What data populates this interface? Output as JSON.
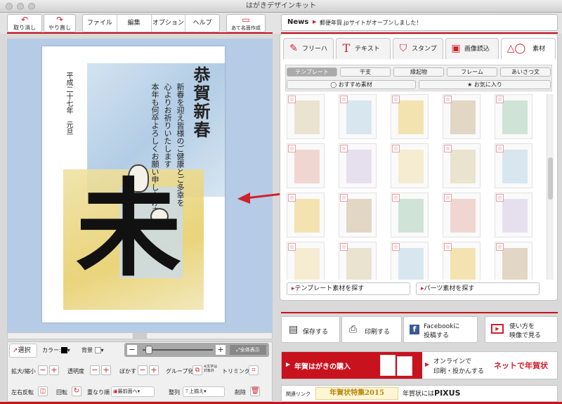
{
  "window": {
    "title": "はがきデザインキット"
  },
  "toolbar": {
    "undo": "取り消し",
    "redo": "やり直し",
    "menus": [
      "ファイル",
      "編集",
      "オプション",
      "ヘルプ"
    ],
    "address": "あて名面作成"
  },
  "news": {
    "label": "News",
    "text": "郵便年賀.jpサイトがオープンしました！"
  },
  "card": {
    "date": "平成二十七年　元旦",
    "greeting": "恭賀新春",
    "message_lines": [
      "新春を迎え皆様のご健康とご多幸を",
      "心よりお祈りいたします",
      "本年も何卒よろしくお願い申し上げます"
    ],
    "kanji": "未"
  },
  "tabs": [
    {
      "label": "フリーハンド",
      "icon": "pencil-icon"
    },
    {
      "label": "テキスト",
      "icon": "text-icon"
    },
    {
      "label": "スタンプ",
      "icon": "stamp-icon"
    },
    {
      "label": "画像読込",
      "icon": "image-icon"
    },
    {
      "label": "素材",
      "icon": "shapes-icon"
    }
  ],
  "sub_tabs": [
    "テンプレート",
    "干支",
    "縁起物",
    "フレーム",
    "あいさつ文"
  ],
  "filters": {
    "recommended": "おすすめ素材",
    "favorites": "お気に入り"
  },
  "find": {
    "templates": "テンプレート素材を探す",
    "parts": "パーツ素材を探す"
  },
  "actions": {
    "save": "保存する",
    "print": "印刷する",
    "facebook_line1": "Facebookに",
    "facebook_line2": "投稿する",
    "video_line1": "使い方を",
    "video_line2": "映像で見る"
  },
  "banner": {
    "purchase": "年賀はがきの購入",
    "online_line1": "オンラインで",
    "online_line2": "印刷・投かんする",
    "brand": "ネットで年賀状"
  },
  "related": {
    "label": "関連リンク",
    "special": "年賀状特集2015",
    "pixus_prefix": "年賀状には",
    "pixus": "PIXUS"
  },
  "tools": {
    "select": "選択",
    "color": "カラー:",
    "background": "背景",
    "fit": "全体表示",
    "zoom": "拡大/縮小",
    "opacity": "透明度",
    "blur": "ぼかす",
    "group": "グループ化",
    "text_object_line1": "※文字は",
    "text_object_line2": "対象外",
    "trim": "トリミング",
    "flip": "左右反転",
    "rotate": "回転",
    "order": "重なり順",
    "order_value": "最前面へ",
    "align": "整列",
    "align_value": "上揃え",
    "delete": "削除"
  },
  "colors": {
    "accent": "#c8121e",
    "canvas_bg": "#b6cbe6"
  }
}
